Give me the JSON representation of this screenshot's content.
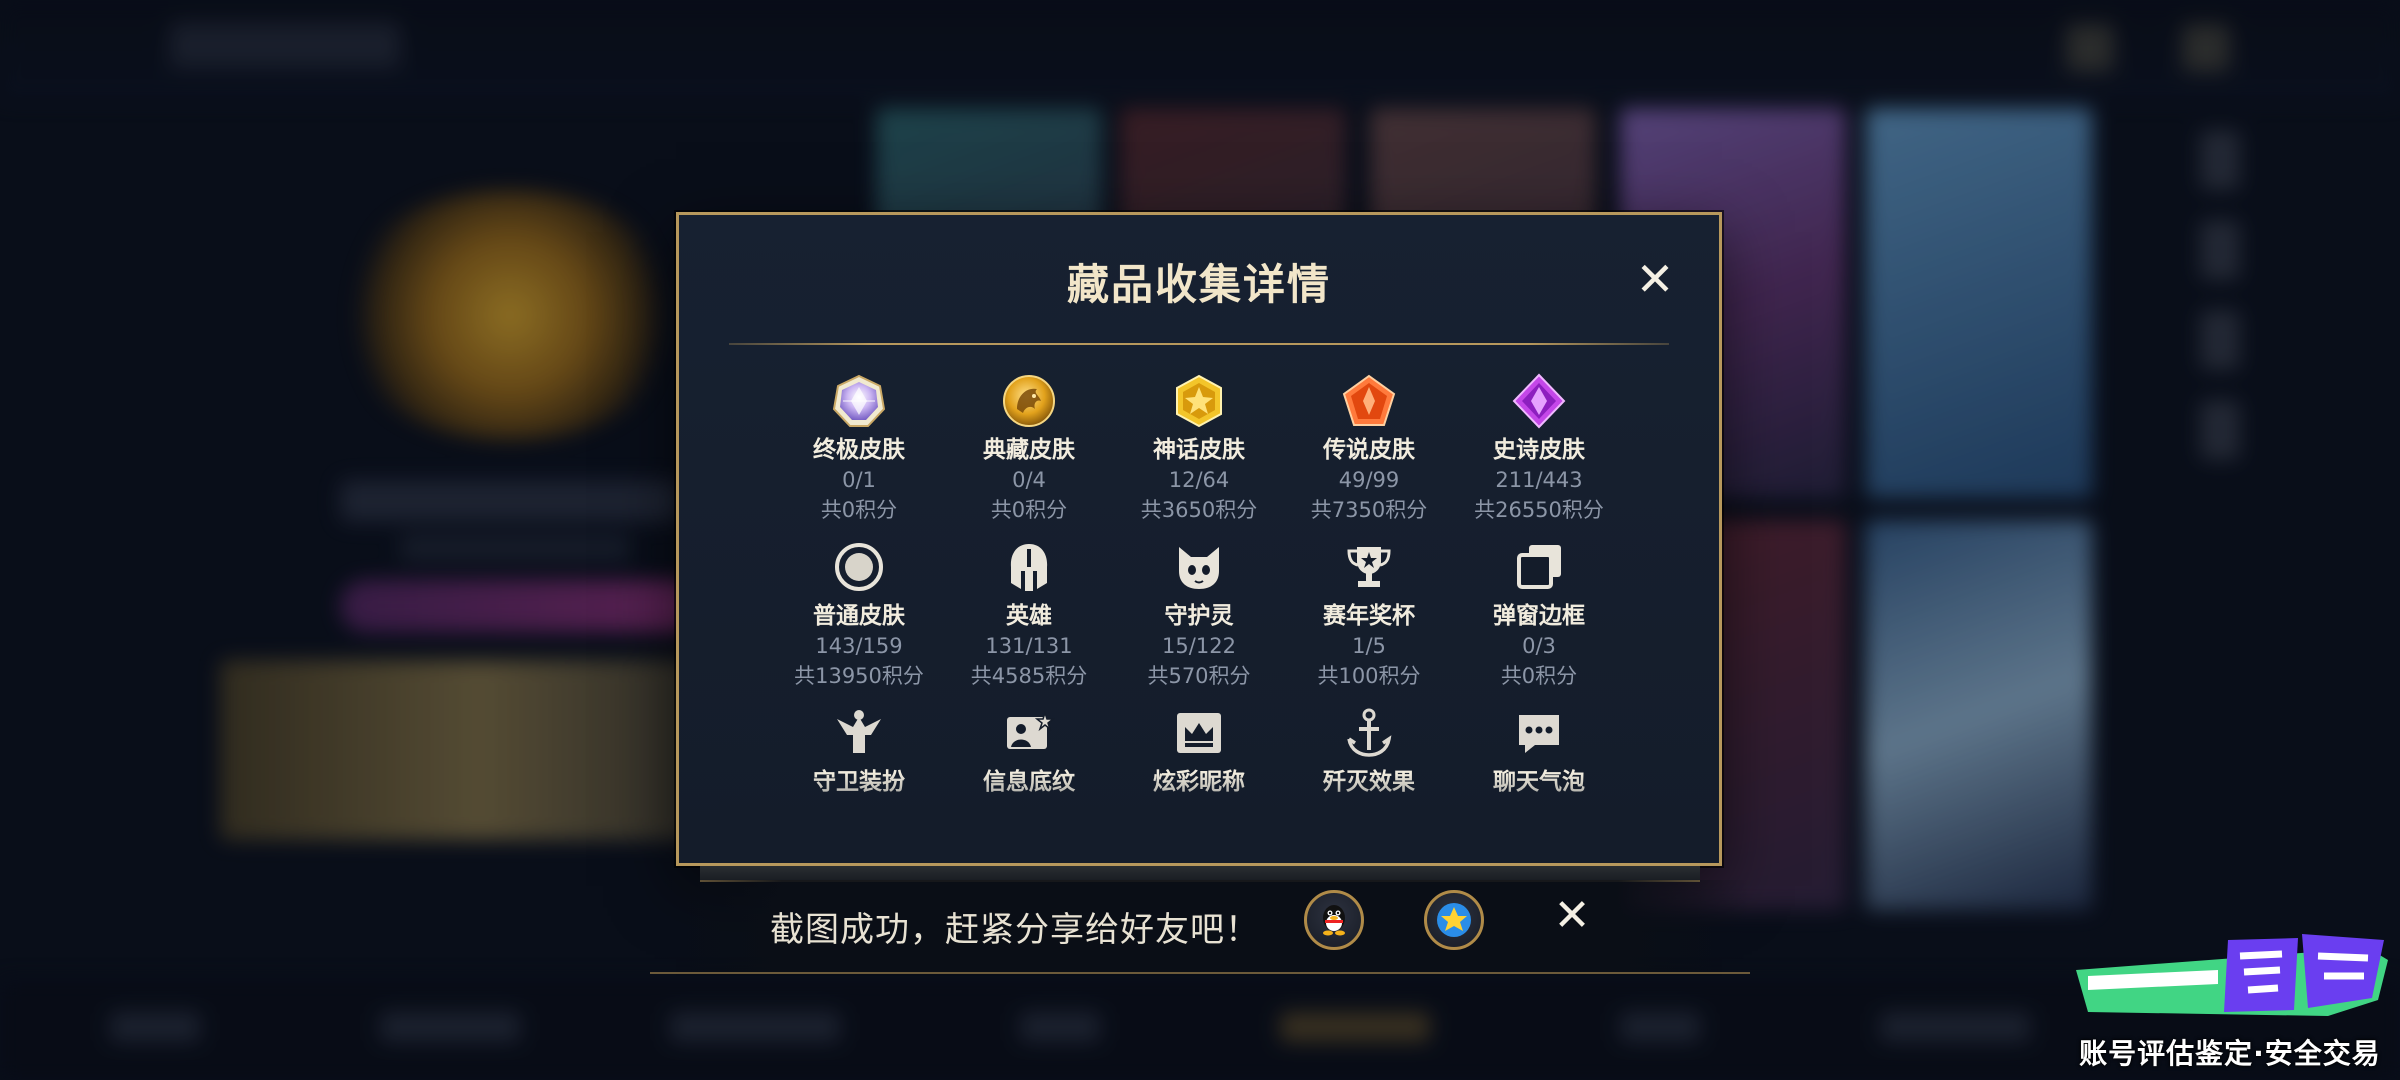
{
  "modal": {
    "title": "藏品收集详情",
    "close_glyph": "✕",
    "items": [
      {
        "name": "终极皮肤",
        "progress": "0/1",
        "points": "共0积分",
        "icon": "ultimate-skin-icon"
      },
      {
        "name": "典藏皮肤",
        "progress": "0/4",
        "points": "共0积分",
        "icon": "collection-skin-icon"
      },
      {
        "name": "神话皮肤",
        "progress": "12/64",
        "points": "共3650积分",
        "icon": "mythic-skin-icon"
      },
      {
        "name": "传说皮肤",
        "progress": "49/99",
        "points": "共7350积分",
        "icon": "legend-skin-icon"
      },
      {
        "name": "史诗皮肤",
        "progress": "211/443",
        "points": "共26550积分",
        "icon": "epic-skin-icon"
      },
      {
        "name": "普通皮肤",
        "progress": "143/159",
        "points": "共13950积分",
        "icon": "normal-skin-icon"
      },
      {
        "name": "英雄",
        "progress": "131/131",
        "points": "共4585积分",
        "icon": "hero-helmet-icon"
      },
      {
        "name": "守护灵",
        "progress": "15/122",
        "points": "共570积分",
        "icon": "guardian-spirit-icon"
      },
      {
        "name": "赛年奖杯",
        "progress": "1/5",
        "points": "共100积分",
        "icon": "trophy-icon"
      },
      {
        "name": "弹窗边框",
        "progress": "0/3",
        "points": "共0积分",
        "icon": "popup-frame-icon"
      },
      {
        "name": "守卫装扮",
        "icon": "guard-outfit-icon"
      },
      {
        "name": "信息底纹",
        "icon": "info-background-icon"
      },
      {
        "name": "炫彩昵称",
        "icon": "colorful-nickname-icon"
      },
      {
        "name": "歼灭效果",
        "icon": "annihilation-effect-icon"
      },
      {
        "name": "聊天气泡",
        "icon": "chat-bubble-icon"
      }
    ]
  },
  "toast": {
    "text": "截图成功，赶紧分享给好友吧！",
    "close_glyph": "✕"
  },
  "watermark": {
    "tagline": "账号评估鉴定·安全交易"
  },
  "colors": {
    "gold_border": "#b7985c",
    "panel_bg": "#172131",
    "title_text": "#f2e6c9",
    "muted_text": "#8c96a7",
    "logo_green": "#45e08a",
    "logo_purple": "#6a3ef0"
  }
}
